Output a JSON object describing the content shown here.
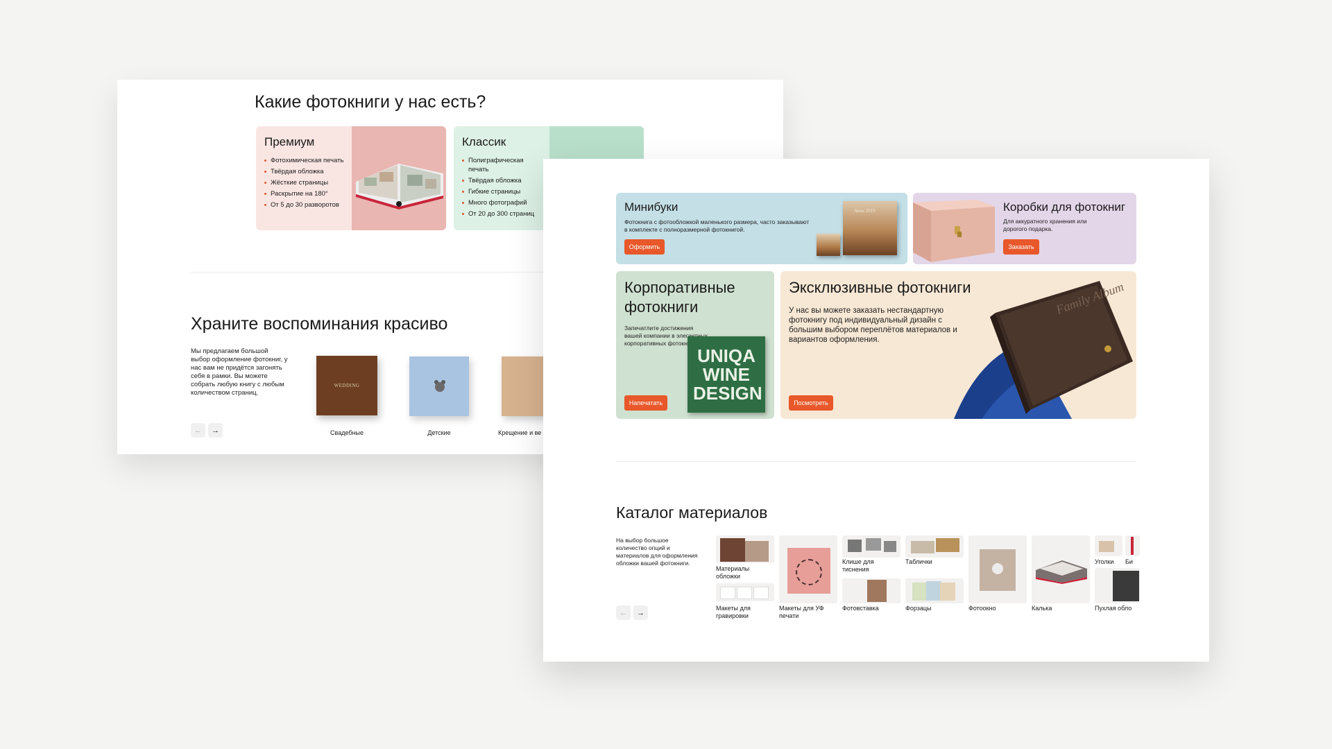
{
  "back": {
    "title": "Какие фотокниги у нас есть?",
    "cards": [
      {
        "title": "Премиум",
        "features": [
          "Фотохимическая печать",
          "Твёрдая обложка",
          "Жёсткие страницы",
          "Раскрытие на 180°",
          "От 5 до 30 разворотов"
        ]
      },
      {
        "title": "Классик",
        "features": [
          "Полиграфическая печать",
          "Твёрдая обложка",
          "Гибкие страницы",
          "Много фотографий",
          "От 20 до 300 страниц"
        ]
      }
    ],
    "section2_title": "Храните воспоминания красиво",
    "section2_text": "Мы предлагаем большой выбор оформление фотокниг, у нас вам не придётся загонять себя в рамки. Вы можете собрать любую книгу с любым количеством страниц.",
    "books": [
      {
        "label": "Свадебные",
        "cover_text": "WEDDING"
      },
      {
        "label": "Детские"
      },
      {
        "label": "Крещение и ве"
      }
    ],
    "arrows": {
      "prev": "←",
      "next": "→"
    }
  },
  "front": {
    "mini": {
      "title": "Минибуки",
      "text": "Фотокнига с фотообложкой маленького размера, часто заказывают в комплекте с полноразмерной фотокнигой.",
      "button": "Оформить",
      "cover_text": "Анна 2019"
    },
    "boxes": {
      "title": "Коробки для фотокниг",
      "text": "Для аккуратного хранения или дорогого подарка.",
      "button": "Заказать"
    },
    "corp": {
      "title": "Корпоративные фотокниги",
      "text": "Запечатлите достижения вашей компании в элегантных корпоративных фотокнигах.",
      "button": "Напечатать",
      "book_text": "UNIQA WINE DESIGN"
    },
    "excl": {
      "title": "Эксклюзивные фотокниги",
      "text": "У нас вы можете заказать нестандартную фотокнигу под индивидуальный дизайн с большим выбором переплётов материалов и вариантов оформления.",
      "button": "Посмотреть",
      "album_text": "Family Album"
    },
    "catalog": {
      "title": "Каталог материалов",
      "text": "На выбор большое количество опций и материалов для оформления обложки вашей фотокниги.",
      "items": [
        "Материалы обложки",
        "Макеты для гравировки",
        "Макеты для УФ печати",
        "Клише для тиснения",
        "Фотовставка",
        "Таблички",
        "Форзацы",
        "Фотоокно",
        "Калька",
        "Уголки",
        "Би",
        "Пухлая обло"
      ]
    },
    "arrows": {
      "prev": "←",
      "next": "→"
    }
  }
}
